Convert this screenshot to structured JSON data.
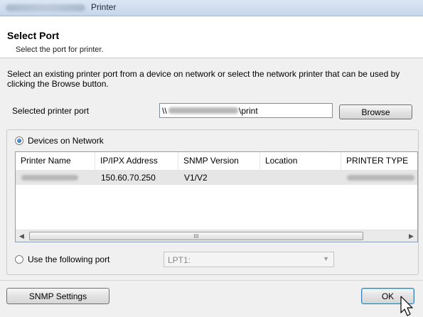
{
  "window": {
    "title": "Printer"
  },
  "header": {
    "title": "Select Port",
    "subtitle": "Select the port for printer."
  },
  "instructions": "Select an existing printer port from a device on network or select the network printer that can be used by clicking the Browse button.",
  "selected_port": {
    "label": "Selected printer port",
    "value_prefix": "\\\\",
    "value_suffix": "\\print",
    "browse_label": "Browse"
  },
  "devices": {
    "radio_label": "Devices on Network",
    "columns": [
      "Printer Name",
      "IP/IPX Address",
      "SNMP Version",
      "Location",
      "PRINTER TYPE"
    ],
    "rows": [
      {
        "ip": "150.60.70.250",
        "snmp": "V1/V2"
      }
    ],
    "scroll_grip": "III"
  },
  "use_port": {
    "radio_label": "Use the following port",
    "value": "LPT1:"
  },
  "buttons": {
    "snmp": "SNMP Settings",
    "ok": "OK"
  }
}
